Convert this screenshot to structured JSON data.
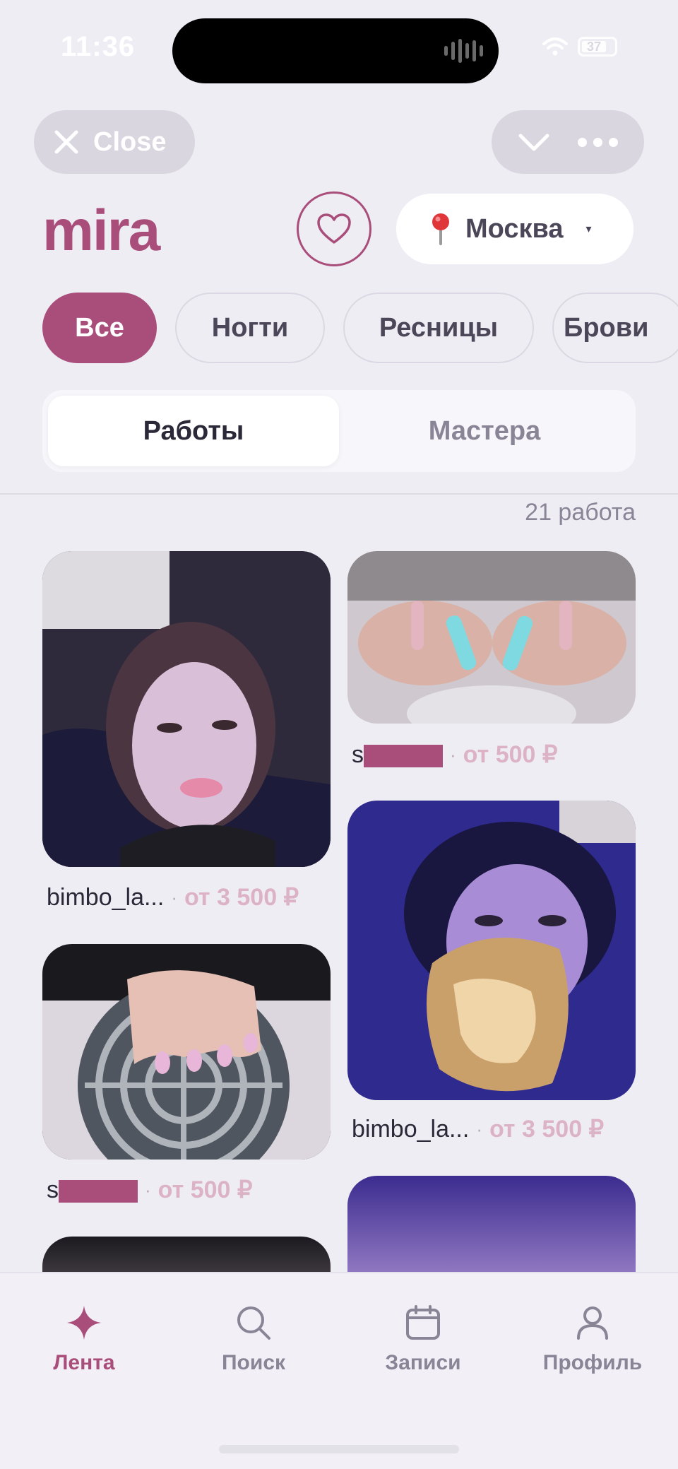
{
  "status_bar": {
    "time": "11:36",
    "battery": "37"
  },
  "miniapp_bar": {
    "close_label": "Close"
  },
  "header": {
    "logo": "mira",
    "city": "Москва",
    "city_caret": "▾"
  },
  "categories": [
    "Все",
    "Ногти",
    "Ресницы",
    "Брови"
  ],
  "segments": [
    "Работы",
    "Мастера"
  ],
  "count_label": "21 работа",
  "cards": [
    {
      "author": "bimbo_la...",
      "price": "от 3 500 ₽"
    },
    {
      "author": "s",
      "price": "от 500 ₽"
    },
    {
      "author": "bimbo_la...",
      "price": "от 3 500 ₽"
    },
    {
      "author": "s",
      "price": "от 500 ₽"
    }
  ],
  "caption_sep": "·",
  "tabs": [
    "Лента",
    "Поиск",
    "Записи",
    "Профиль"
  ],
  "colors": {
    "accent": "#a94d7b",
    "background": "#efedf4",
    "price": "#dcb3c5"
  },
  "icons": [
    "close-icon",
    "chevron-down-icon",
    "more-icon",
    "heart-icon",
    "pin-icon",
    "sparkle-icon",
    "search-icon",
    "calendar-icon",
    "profile-icon"
  ]
}
